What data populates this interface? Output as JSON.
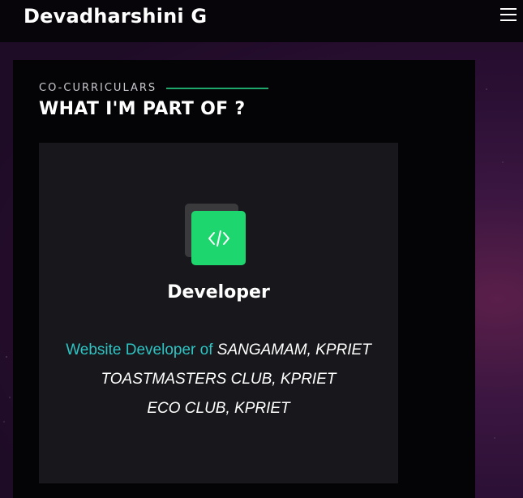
{
  "header": {
    "brand": "Devadharshini G",
    "menu_icon": "hamburger-menu-icon"
  },
  "section": {
    "eyebrow": "CO-CURRICULARS",
    "heading": "WHAT I'M PART OF ?"
  },
  "card": {
    "icon": "code-icon",
    "title": "Developer",
    "desc_prefix": "Website Developer of",
    "line1": "SANGAMAM, KPRIET",
    "line2": "TOASTMASTERS CLUB, KPRIET",
    "line3": "ECO CLUB, KPRIET"
  },
  "colors": {
    "accent_green": "#1ed66e",
    "accent_teal": "#2ec4c4",
    "divider_green": "#1fa86b"
  }
}
